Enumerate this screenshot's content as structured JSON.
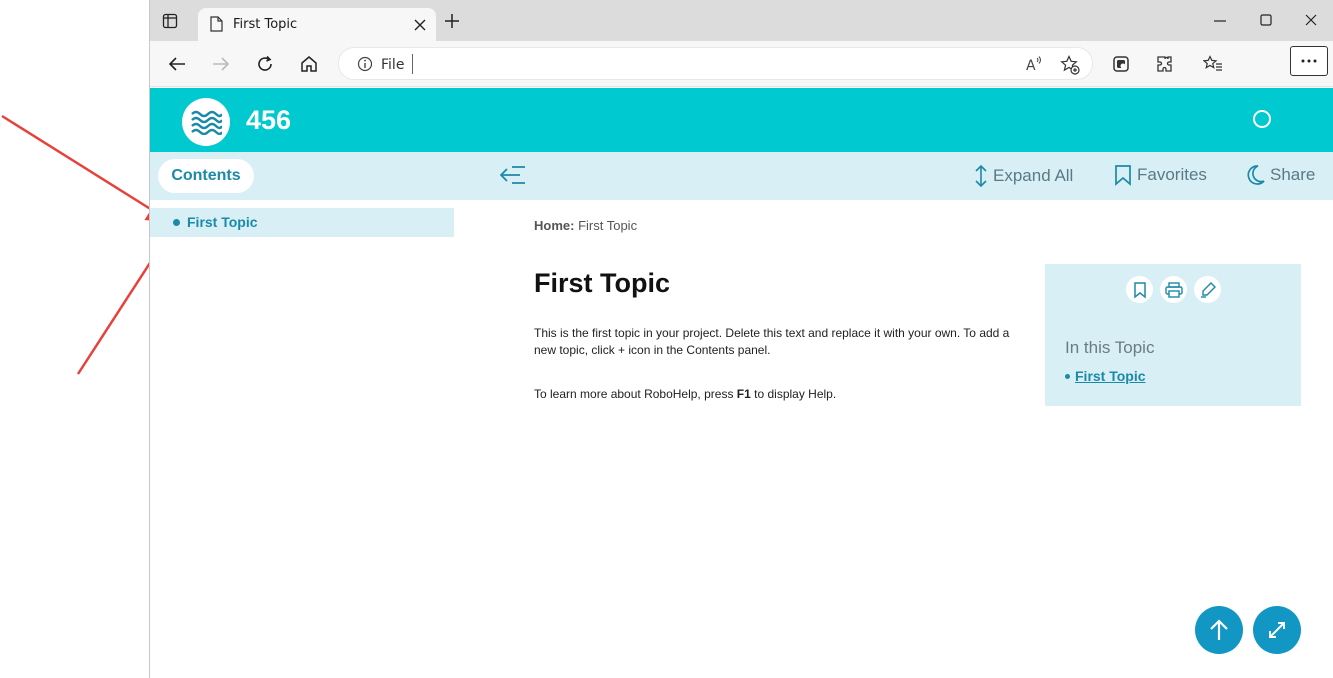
{
  "browser": {
    "tab_title": "First Topic",
    "address_text": "File"
  },
  "site": {
    "title": "456"
  },
  "subheader": {
    "contents_label": "Contents",
    "expand_all_label": "Expand All",
    "favorites_label": "Favorites",
    "share_label": "Share"
  },
  "sidebar": {
    "items": [
      {
        "label": "First Topic",
        "selected": true
      }
    ]
  },
  "content": {
    "breadcrumb_home": "Home:",
    "breadcrumb_current": "First Topic",
    "title": "First Topic",
    "para1": "This is the first topic in your project. Delete this text and replace it with your own. To add a new topic, click + icon in the Contents panel.",
    "para2_before": "To learn more about RoboHelp, press ",
    "para2_key": "F1",
    "para2_after": " to display Help."
  },
  "topic_panel": {
    "heading": "In this Topic",
    "link": "First Topic"
  },
  "colors": {
    "header_teal": "#00c9cf",
    "accent_blue": "#1b8aa8",
    "panel_light": "#d8eff6",
    "fab_blue": "#1296c4",
    "arrow_red": "#e8413a"
  },
  "icons": {
    "browser": [
      "tab-actions-icon",
      "page-icon",
      "close-icon",
      "plus-icon",
      "minimize-icon",
      "maximize-icon",
      "window-close-icon",
      "back-icon",
      "forward-icon",
      "refresh-icon",
      "home-icon",
      "info-icon",
      "read-aloud-icon",
      "favorite-add-icon",
      "collections-icon",
      "extensions-icon",
      "favorites-icon",
      "more-icon"
    ],
    "page": [
      "waves-logo-icon",
      "search-icon",
      "collapse-sidebar-icon",
      "expand-all-icon",
      "bookmark-icon",
      "moon-icon",
      "bookmark-icon",
      "print-icon",
      "highlight-icon",
      "arrow-up-icon",
      "expand-icon"
    ]
  }
}
